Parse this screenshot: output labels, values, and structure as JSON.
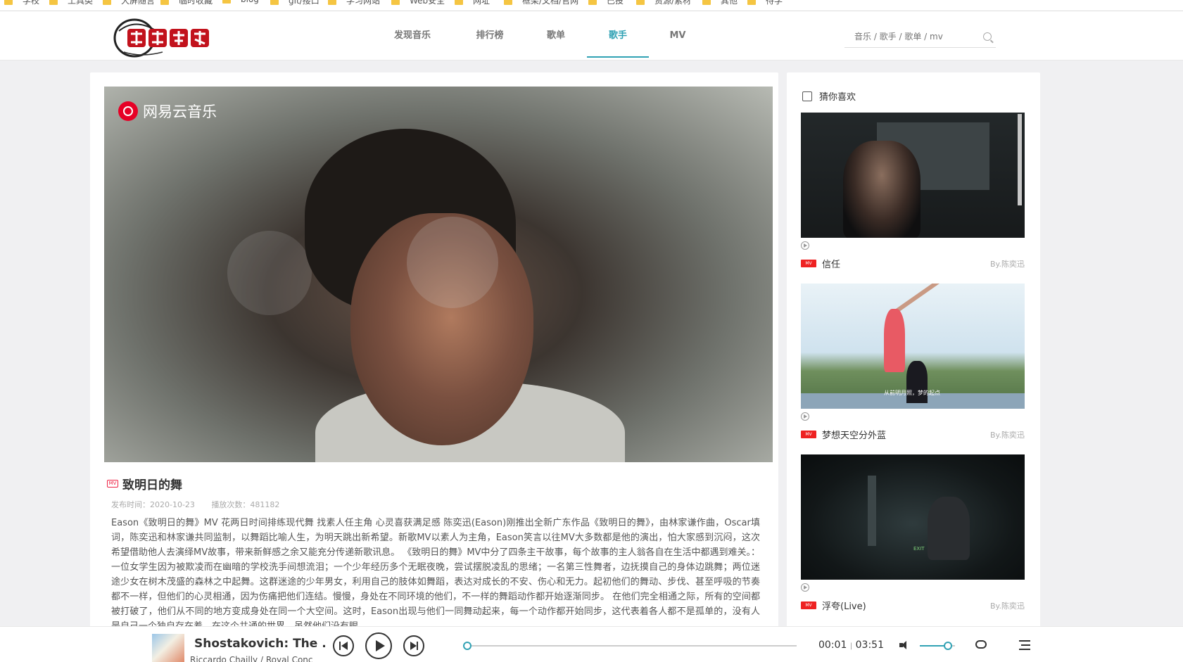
{
  "bookmarks": [
    {
      "label": "学校"
    },
    {
      "label": "工具类"
    },
    {
      "label": "大屏随言"
    },
    {
      "label": "临时收藏"
    },
    {
      "label": "blog"
    },
    {
      "label": "git/接口"
    },
    {
      "label": "学习网站"
    },
    {
      "label": "Web安全"
    },
    {
      "label": "网址"
    },
    {
      "label": "框架/文档/官网"
    },
    {
      "label": "已投"
    },
    {
      "label": "资源/素材"
    },
    {
      "label": "其他"
    },
    {
      "label": "待学"
    }
  ],
  "header": {
    "nav": [
      {
        "label": "发现音乐",
        "active": false
      },
      {
        "label": "排行榜",
        "active": false
      },
      {
        "label": "歌单",
        "active": false
      },
      {
        "label": "歌手",
        "active": true
      },
      {
        "label": "MV",
        "active": false
      }
    ],
    "search_placeholder": "音乐 / 歌手 / 歌单 / mv"
  },
  "video": {
    "watermark": "网易云音乐"
  },
  "mv": {
    "badge": "MV",
    "title": "致明日的舞",
    "publish_time": "发布时间：2020-10-23",
    "play_count": "播放次数：481182",
    "description": "Eason《致明日的舞》MV  花两日时间排练现代舞 找素人任主角 心灵喜获满足感   陈奕迅(Eason)刚推出全新广东作品《致明日的舞》，由林家谦作曲，Oscar填词，陈奕迅和林家谦共同监制，以舞蹈比喻人生，为明天跳出新希望。新歌MV以素人为主角，Eason笑言以往MV大多数都是他的演出，怕大家感到沉闷，这次希望借助他人去演绎MV故事，带来新鲜感之余又能充分传递新歌讯息。   《致明日的舞》MV中分了四条主干故事，每个故事的主人翁各自在生活中都遇到难关。：一位女学生因为被欺凌而在幽暗的学校洗手间想流泪；一个少年经历多个无眠夜晚，尝试摆脱凌乱的思绪；一名第三性舞者，边抚摸自己的身体边跳舞；两位迷途少女在树木茂盛的森林之中起舞。这群迷途的少年男女，利用自己的肢体如舞蹈，表达对成长的不安、伤心和无力。起初他们的舞动、步伐、甚至呼吸的节奏都不一样，但他们的心灵相通，因为伤痛把他们连结。慢慢，身处在不同环境的他们，不一样的舞蹈动作都开始逐渐同步。   在他们完全相通之际，所有的空间都被打破了，他们从不同的地方变成身处在同一个大空间。这时，Eason出现与他们一同舞动起来，每一个动作都开始同步，这代表着各人都不是孤单的，没有人是自己一个独自存在着，在这个共通的世界，虽然他们没有眼"
  },
  "sidebar": {
    "title": "猜你喜欢",
    "items": [
      {
        "name": "信任",
        "by": "By.陈奕迅",
        "badge": "MV"
      },
      {
        "name": "梦想天空分外蓝",
        "by": "By.陈奕迅",
        "badge": "MV",
        "caption": "从前明月照，梦的起点"
      },
      {
        "name": "浮夸(Live)",
        "by": "By.陈奕迅",
        "badge": "MV",
        "caption": "EXIT"
      }
    ]
  },
  "player": {
    "title": "Shostakovich: The ...",
    "artist": "Riccardo Chailly / Royal Conc",
    "current_time": "00:01",
    "separator": "|",
    "total_time": "03:51",
    "progress_percent": 0.4,
    "volume_percent": 80,
    "accent": "#31a2b4"
  },
  "colors": {
    "accent": "#31a2b4",
    "mv_red": "#e22222"
  }
}
